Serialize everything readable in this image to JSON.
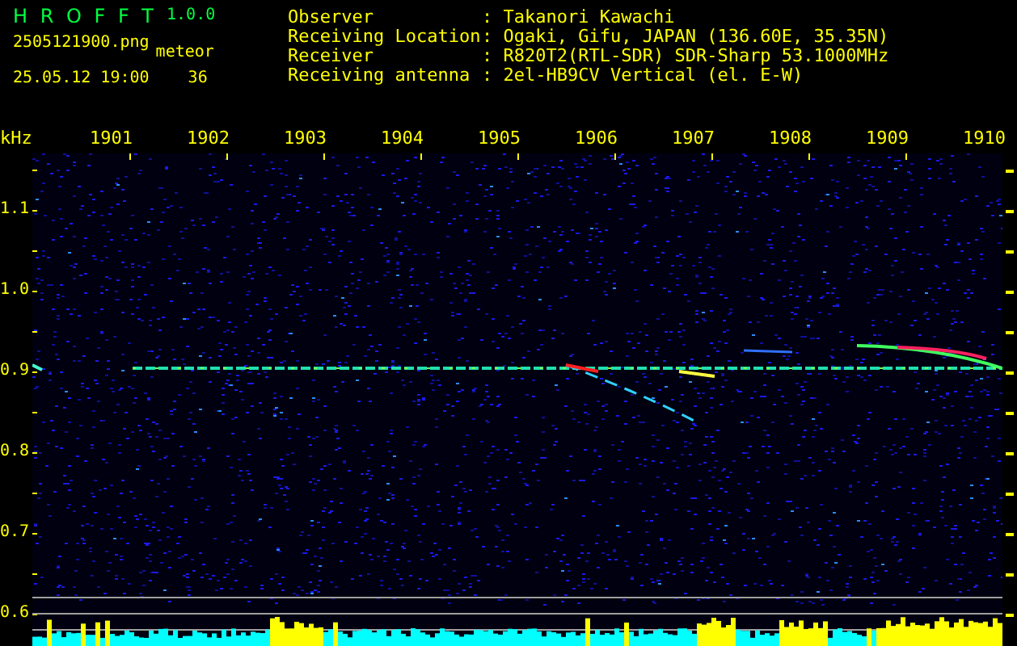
{
  "app": {
    "name": "H R O F F T",
    "version": "1.0.0"
  },
  "file": "2505121900.png",
  "datetime": "25.05.12 19:00",
  "detection": {
    "label": "meteor",
    "count": "36"
  },
  "station": [
    {
      "label": "Observer",
      "value": ": Takanori Kawachi"
    },
    {
      "label": "Receiving Location",
      "value": ": Ogaki, Gifu, JAPAN (136.60E, 35.35N)"
    },
    {
      "label": "Receiver",
      "value": ": R820T2(RTL-SDR) SDR-Sharp 53.1000MHz"
    },
    {
      "label": "Receiving antenna",
      "value": ": 2el-HB9CV Vertical (el. E-W)"
    }
  ],
  "spectrogram": {
    "unit": "kHz",
    "time_labels": [
      "1901",
      "1902",
      "1903",
      "1904",
      "1905",
      "1906",
      "1907",
      "1908",
      "1909",
      "1910"
    ],
    "freq_labels": [
      "1.1",
      "1.0",
      "0.9",
      "0.8",
      "0.7",
      "0.6"
    ]
  }
}
